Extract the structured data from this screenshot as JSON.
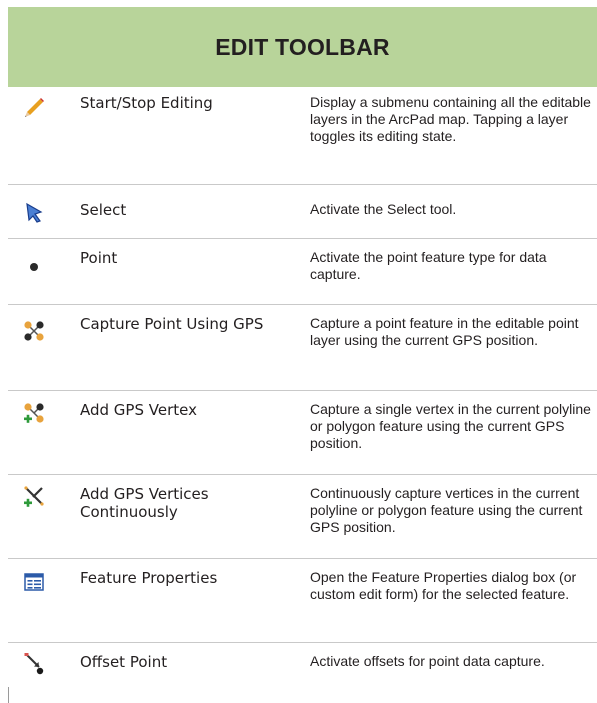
{
  "header": {
    "title": "EDIT TOOLBAR"
  },
  "rows": [
    {
      "icon": "pencil-icon",
      "command": "Start/Stop Editing",
      "description": "Display a submenu containing all the editable layers in the ArcPad map. Tapping a layer toggles its editing state."
    },
    {
      "icon": "select-arrow-icon",
      "command": "Select",
      "description": "Activate the Select tool."
    },
    {
      "icon": "point-icon",
      "command": "Point",
      "description": "Activate the point feature type for data capture."
    },
    {
      "icon": "capture-point-gps-icon",
      "command": "Capture Point Using GPS",
      "description": "Capture a point feature in the editable point layer using the current GPS position."
    },
    {
      "icon": "add-gps-vertex-icon",
      "command": "Add GPS Vertex",
      "description": "Capture a single vertex in the current polyline or polygon feature using the current GPS position."
    },
    {
      "icon": "add-gps-vertices-continuously-icon",
      "command": "Add GPS Vertices Continuously",
      "description": "Continuously capture vertices in the current polyline or polygon feature using the current GPS position."
    },
    {
      "icon": "feature-properties-icon",
      "command": "Feature Properties",
      "description": "Open the Feature Properties dialog box (or custom edit form) for the selected feature."
    },
    {
      "icon": "offset-point-icon",
      "command": "Offset Point",
      "description": "Activate offsets for point data capture."
    }
  ],
  "colors": {
    "header_bg": "#b8d49a",
    "text": "#231f20",
    "divider": "#c9c9c9"
  }
}
